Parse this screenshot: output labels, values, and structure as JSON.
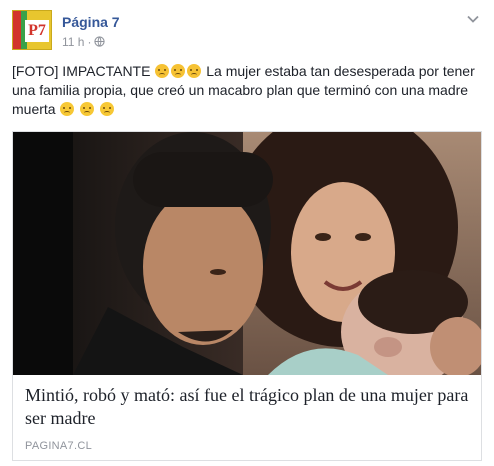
{
  "post": {
    "page_name": "Página 7",
    "avatar_text": "P7",
    "time": "11 h",
    "separator": "·",
    "text_before_emojis": "[FOTO] IMPACTANTE ",
    "text_middle": " La mujer estaba tan desesperada por tener una familia propia, que creó un macabro plan que terminó con una madre muerta ",
    "emojis_group1": [
      "crying-face",
      "crying-face",
      "crying-face"
    ],
    "emojis_group2": [
      "sad-face",
      "sad-face",
      "sad-face"
    ]
  },
  "link": {
    "title": "Mintió, robó y mató: así fue el trágico plan de una mujer para ser madre",
    "domain": "PAGINA7.CL"
  },
  "colors": {
    "page_name": "#365899",
    "meta": "#90949c",
    "avatar_yellow": "#e8c62e",
    "avatar_red": "#d2342b",
    "avatar_green": "#3aa14a"
  }
}
